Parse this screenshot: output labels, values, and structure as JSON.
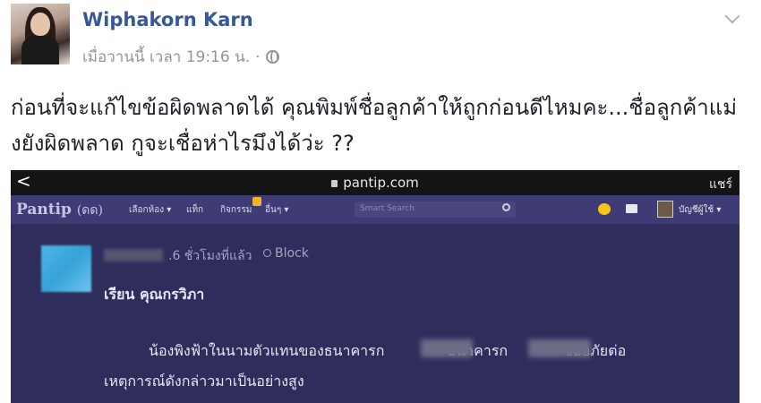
{
  "post": {
    "author": "Wiphakorn Karn",
    "timestamp": "เมื่อวานนี้ เวลา 19:16 น.",
    "separator": "·",
    "text": "ก่อนที่จะแก้ไขข้อผิดพลาดได้ คุณพิมพ์ชื่อลูกค้าให้ถูกก่อนดีไหมคะ...ชื่อลูกค้าแม่งยังผิดพลาด กูจะเชื่อห่าไรมึงได้ว่ะ ??"
  },
  "screenshot": {
    "browser": {
      "back": "<",
      "url": "pantip.com",
      "share": "แชร์"
    },
    "pantip": {
      "logo": "Pantip",
      "logo_mark": "(ดด)",
      "menu": [
        "เลือกห้อง ▾",
        "แท็ก",
        "กิจกรรม",
        "อื่นๆ ▾"
      ],
      "search_placeholder": "Smart Search",
      "user": "บัญชีผู้ใช้ ▾"
    },
    "comment": {
      "time_ago": ".6 ชั่วโมงที่แล้ว",
      "block": "Block",
      "greeting": "เรียน คุณกรวิภา",
      "line1a": "น้องพิงฟ้าในนามตัวแทนของธนาคารก",
      "line1b": "ธนาคารก",
      "line1c": "ขออภัยต่อ",
      "line2": "เหตุการณ์ดังกล่าวมาเป็นอย่างสูง"
    }
  },
  "colors": {
    "author_link": "#365899",
    "meta_gray": "#90949c",
    "pantip_bg": "#2e2d5c",
    "pantip_nav": "#3e3b75"
  }
}
